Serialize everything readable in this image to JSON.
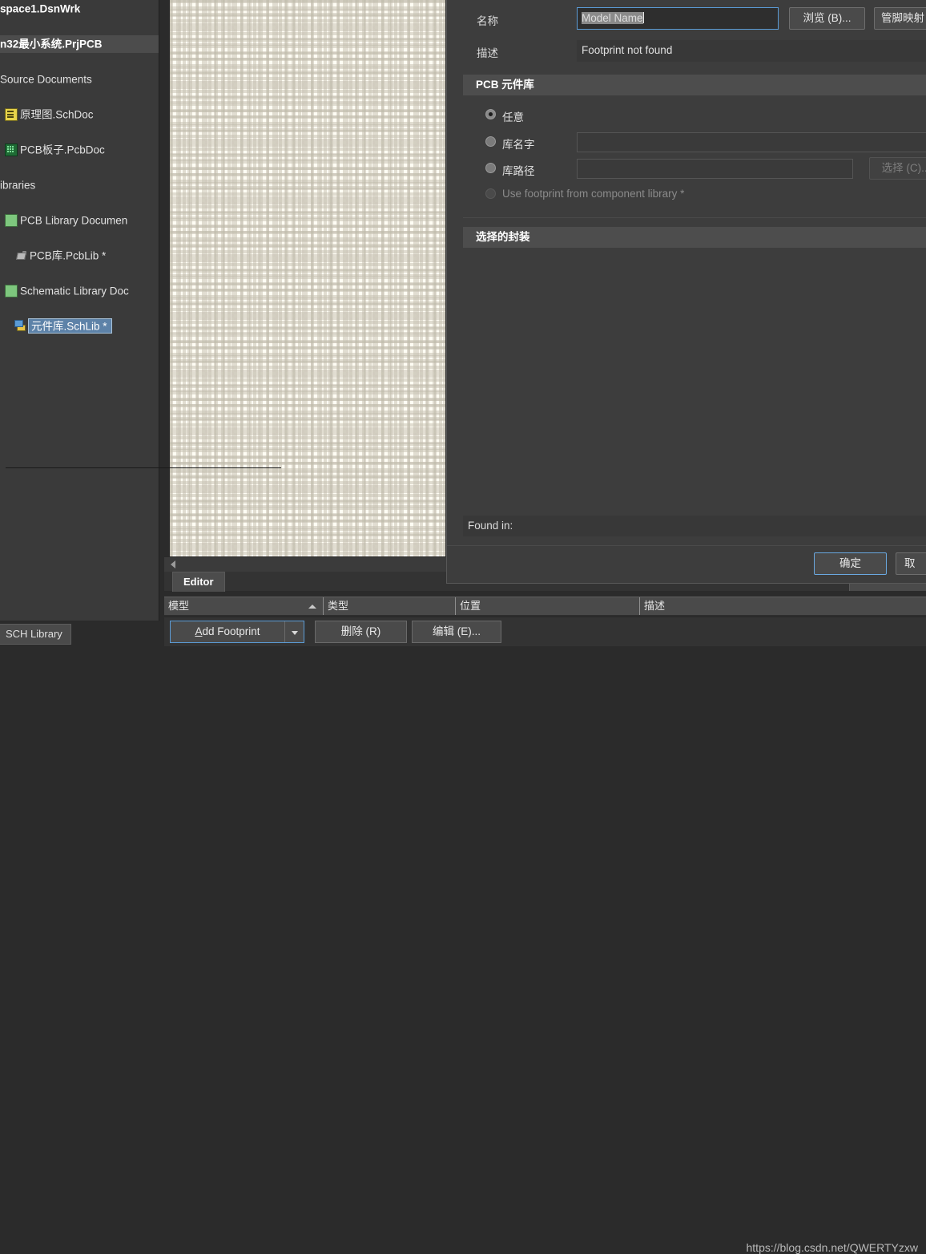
{
  "project_panel": {
    "tree": [
      {
        "label": "space1.DsnWrk",
        "icon": "none",
        "indent": 0,
        "style": "bold-plain"
      },
      {
        "label": "n32最小系统.PrjPCB",
        "icon": "none",
        "indent": 0,
        "style": "bold-band"
      },
      {
        "label": "Source Documents",
        "icon": "none",
        "indent": 0,
        "style": "plain"
      },
      {
        "label": "原理图.SchDoc",
        "icon": "sch-doc-icon",
        "indent": 0,
        "style": "plain"
      },
      {
        "label": "PCB板子.PcbDoc",
        "icon": "pcb-doc-icon",
        "indent": 0,
        "style": "plain"
      },
      {
        "label": "ibraries",
        "icon": "none",
        "indent": 0,
        "style": "plain"
      },
      {
        "label": "PCB Library Documen",
        "icon": "folder-icon",
        "indent": 0,
        "style": "plain"
      },
      {
        "label": "PCB库.PcbLib *",
        "icon": "pcblib-icon",
        "indent": 1,
        "style": "plain"
      },
      {
        "label": "Schematic Library Doc",
        "icon": "folder-icon",
        "indent": 0,
        "style": "plain"
      },
      {
        "label": "元件库.SchLib *",
        "icon": "schlib-icon",
        "indent": 1,
        "style": "selected"
      }
    ],
    "bottom_tab": "SCH Library"
  },
  "editor": {
    "tab_label": "Editor",
    "grid_columns": [
      "模型",
      "类型",
      "位置",
      "描述"
    ],
    "buttons": {
      "add_footprint": "Add Footprint",
      "add_footprint_accel": "A",
      "delete": "删除 (R)",
      "edit": "编辑 (E)..."
    },
    "watermark": "https://blog.csdn.net/QWERTYzxw"
  },
  "dialog": {
    "name_label": "名称",
    "name_value": "Model Name",
    "desc_label": "描述",
    "desc_value": "Footprint not found",
    "browse_button": "浏览 (B)...",
    "pin_map_button": "管脚映射 (P",
    "pcb_library": {
      "header": "PCB 元件库",
      "options": [
        {
          "label": "任意",
          "selected": true,
          "disabled": false
        },
        {
          "label": "库名字",
          "selected": false,
          "disabled": false
        },
        {
          "label": "库路径",
          "selected": false,
          "disabled": false
        },
        {
          "label": "Use footprint from component library *",
          "selected": false,
          "disabled": true
        }
      ],
      "lib_name_value": "",
      "lib_path_value": "",
      "choose_button": "选择 (C)..."
    },
    "selected_footprint": {
      "header": "选择的封装",
      "found_in_label": "Found in:",
      "found_in_value": ""
    },
    "footer": {
      "ok": "确定",
      "cancel": "取"
    }
  },
  "colors": {
    "accent_blue": "#5b9bd5",
    "selection_blue": "#5d82a8",
    "panel_bg": "#3a3a3a",
    "dialog_bg": "#3d3d3d",
    "canvas_bg": "#fffdf4"
  }
}
